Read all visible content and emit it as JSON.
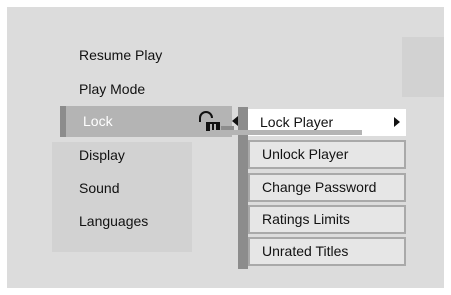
{
  "menu": {
    "items": [
      {
        "label": "Resume Play"
      },
      {
        "label": "Play Mode"
      },
      {
        "label": "Lock"
      },
      {
        "label": "Display"
      },
      {
        "label": "Sound"
      },
      {
        "label": "Languages"
      }
    ],
    "selected": "Lock"
  },
  "submenu": {
    "items": [
      {
        "label": "Lock Player"
      },
      {
        "label": "Unlock Player"
      },
      {
        "label": "Change Password"
      },
      {
        "label": "Ratings Limits"
      },
      {
        "label": "Unrated Titles"
      }
    ],
    "highlighted": "Lock Player"
  },
  "icons": {
    "lock": "padlock-icon",
    "open_arrow": "triangle-left-icon",
    "submenu_arrow": "triangle-right-icon"
  },
  "colors": {
    "background": "#dcdcdc",
    "selection_bar": "#b4b4b4",
    "accent_strip": "#8c8c8c",
    "submenu_item": "#e6e6e6",
    "highlight": "#ffffff"
  }
}
